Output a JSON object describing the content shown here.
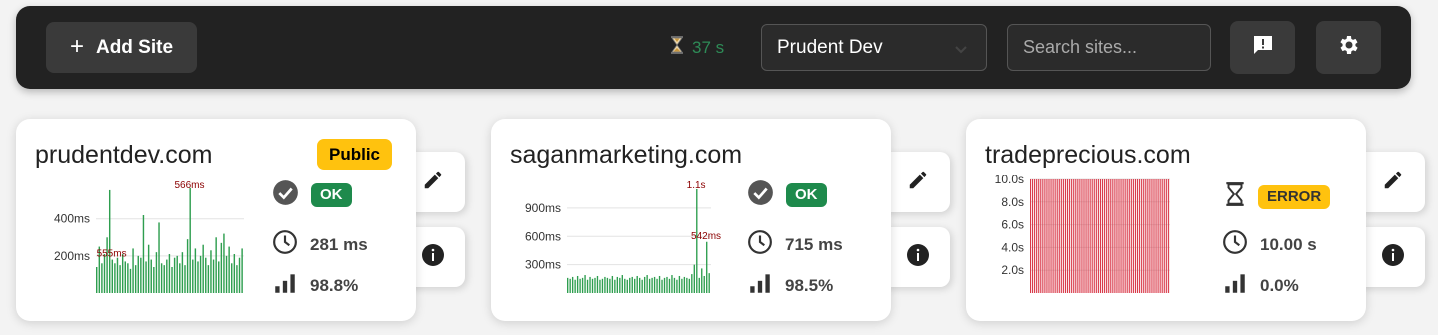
{
  "toolbar": {
    "add_site_label": "Add Site",
    "timer_text": "37 s",
    "account_selected": "Prudent Dev",
    "search_placeholder": "Search sites...",
    "colors": {
      "bg": "#222222",
      "button": "#3a3a3a",
      "timer": "#2e8b57"
    }
  },
  "sites": [
    {
      "domain": "prudentdev.com",
      "visibility_badge": "Public",
      "status_icon": "check-circle-icon",
      "status_label": "OK",
      "response_time": "281 ms",
      "uptime": "98.8%",
      "chart_data": {
        "type": "bar",
        "color": "#2e9e4f",
        "ylabels": [
          "400ms",
          "200ms"
        ],
        "yticks": [
          400,
          200
        ],
        "ymax": 560,
        "peaks": [
          {
            "label": "555ms",
            "index": 6
          },
          {
            "label": "566ms",
            "index": 36
          }
        ],
        "values": [
          140,
          250,
          160,
          210,
          300,
          555,
          180,
          160,
          190,
          150,
          210,
          170,
          160,
          130,
          240,
          150,
          200,
          190,
          420,
          170,
          260,
          180,
          140,
          220,
          380,
          160,
          150,
          180,
          210,
          140,
          190,
          200,
          160,
          220,
          150,
          290,
          566,
          180,
          240,
          170,
          200,
          260,
          190,
          150,
          230,
          180,
          300,
          170,
          270,
          320,
          200,
          250,
          160,
          210,
          150,
          190,
          240
        ]
      }
    },
    {
      "domain": "saganmarketing.com",
      "status_icon": "check-circle-icon",
      "status_label": "OK",
      "response_time": "715 ms",
      "uptime": "98.5%",
      "chart_data": {
        "type": "bar",
        "color": "#2e9e4f",
        "ylabels": [
          "900ms",
          "600ms",
          "300ms"
        ],
        "yticks": [
          900,
          600,
          300
        ],
        "ymax": 1100,
        "peaks": [
          {
            "label": "1.1s",
            "index": 52
          },
          {
            "label": "542ms",
            "index": 56
          }
        ],
        "values": [
          160,
          150,
          170,
          140,
          180,
          150,
          160,
          190,
          140,
          170,
          150,
          160,
          180,
          140,
          150,
          170,
          160,
          150,
          180,
          140,
          170,
          160,
          190,
          150,
          140,
          160,
          170,
          150,
          180,
          160,
          140,
          170,
          190,
          150,
          160,
          170,
          150,
          180,
          140,
          160,
          170,
          150,
          190,
          160,
          140,
          180,
          150,
          170,
          160,
          150,
          200,
          300,
          1100,
          160,
          260,
          180,
          542,
          210
        ]
      }
    },
    {
      "domain": "tradeprecious.com",
      "status_icon": "hourglass-icon",
      "status_label": "ERROR",
      "response_time": "10.00 s",
      "uptime": "0.0%",
      "chart_data": {
        "type": "bar",
        "color": "#d93a4a",
        "ylabels": [
          "10.0s",
          "8.0s",
          "6.0s",
          "4.0s",
          "2.0s"
        ],
        "yticks": [
          10,
          8,
          6,
          4,
          2
        ],
        "ymax": 10,
        "values": [
          10,
          10,
          10,
          10,
          10,
          10,
          10,
          10,
          10,
          10,
          10,
          10,
          10,
          10,
          10,
          10,
          10,
          10,
          10,
          10,
          10,
          10,
          10,
          10,
          10,
          10,
          10,
          10,
          10,
          10,
          10,
          10,
          10,
          10,
          10,
          10,
          10,
          10,
          10,
          10,
          10,
          10,
          10,
          10,
          10,
          10,
          10,
          10,
          10,
          10,
          10,
          10,
          10,
          10,
          10,
          10,
          10,
          10,
          10,
          10,
          10,
          10,
          10,
          10,
          10,
          10,
          10,
          10,
          10,
          10,
          10,
          10
        ]
      }
    }
  ]
}
